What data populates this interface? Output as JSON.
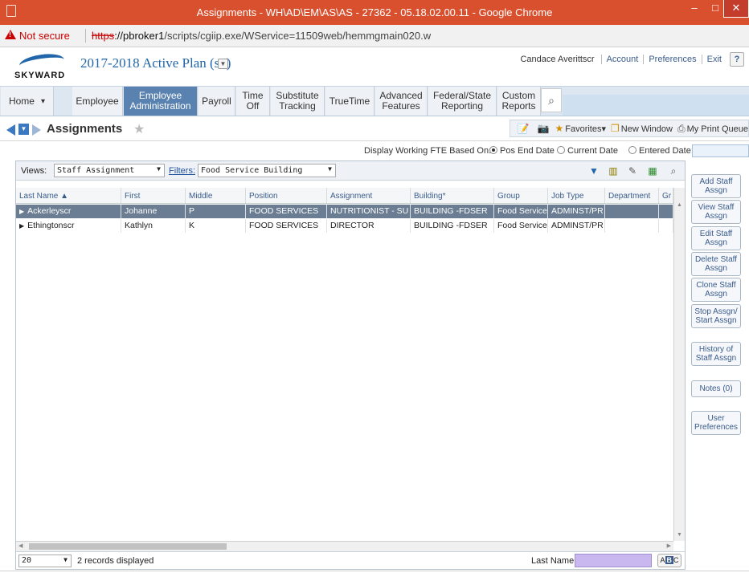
{
  "browser": {
    "title": "Assignments - WH\\AD\\EM\\AS\\AS - 27362 - 05.18.02.00.11 - Google Chrome",
    "not_secure": "Not secure",
    "url_scheme": "https",
    "url_host": "://pbroker1",
    "url_path": "/scripts/cgiip.exe/WService=11509web/hemmgmain020.w",
    "min": "–",
    "max": "□",
    "close": "✕"
  },
  "header": {
    "logo_text": "SKYWARD",
    "plan": "2017-2018 Active Plan (so)",
    "user": "Candace Averittscr",
    "links": [
      "Account",
      "Preferences",
      "Exit"
    ],
    "help": "?"
  },
  "nav": {
    "home": "Home",
    "home_dd": "▾",
    "items": [
      {
        "label": "Employee"
      },
      {
        "label": "Employee Administration"
      },
      {
        "label": "Payroll"
      },
      {
        "label": "Time Off"
      },
      {
        "label": "Substitute Tracking"
      },
      {
        "label": "TrueTime"
      },
      {
        "label": "Advanced Features"
      },
      {
        "label": "Federal/State Reporting"
      },
      {
        "label": "Custom Reports"
      }
    ],
    "search_icon": "🔍"
  },
  "page": {
    "title": "Assignments",
    "favorites": "Favorites",
    "new_window": "New Window",
    "print_queue": "My Print Queue"
  },
  "fte": {
    "label": "Display Working FTE Based On:",
    "options": [
      "Pos End Date",
      "Current Date",
      "Entered Date:"
    ],
    "selected": "Pos End Date",
    "date_value": ""
  },
  "grid": {
    "views_label": "Views:",
    "view_value": "Staff Assignment",
    "filters_label": "Filters:",
    "filter_value": "Food Service Building",
    "columns": [
      "Last Name ▲",
      "First",
      "Middle",
      "Position",
      "Assignment",
      "Building*",
      "Group",
      "Job Type",
      "Department",
      "Gr"
    ],
    "rows": [
      [
        "Ackerleyscr",
        "Johanne",
        "P",
        "FOOD SERVICES",
        "NUTRITIONIST - SU",
        "BUILDING -FDSER",
        "Food Service",
        "ADMINST/PR",
        "",
        ""
      ],
      [
        "Ethingtonscr",
        "Kathlyn",
        "K",
        "FOOD SERVICES",
        "DIRECTOR",
        "BUILDING -FDSER",
        "Food Service",
        "ADMINST/PR",
        "",
        ""
      ]
    ],
    "selected_row": 0,
    "page_size": "20",
    "records_text": "2 records displayed",
    "last_name_label": "Last Name:",
    "last_name_value": "",
    "abc_a": "A",
    "abc_b": "B",
    "abc_c": "C"
  },
  "side_buttons": [
    "Add Staff Assgn",
    "View Staff Assgn",
    "Edit Staff Assgn",
    "Delete Staff Assgn",
    "Clone Staff Assgn",
    "Stop Assgn/ Start Assgn",
    "History of Staff Assgn",
    "Notes (0)",
    "User Preferences"
  ],
  "colors": {
    "title_bar": "#d9502f",
    "nav_active": "#5a82b0",
    "selected_row": "#6a7d92",
    "last_name_box": "#c9b8f0"
  }
}
